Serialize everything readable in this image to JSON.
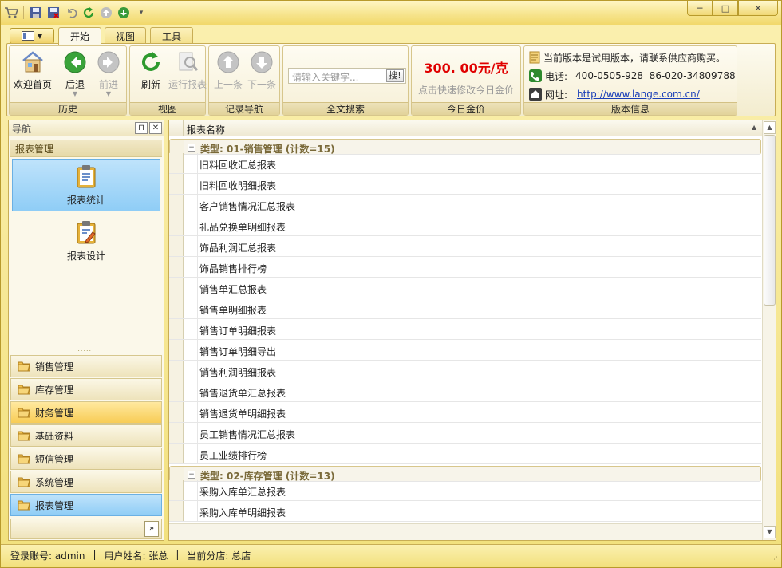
{
  "window": {
    "controls": {
      "minimize": "─",
      "maximize": "□",
      "close": "✕"
    }
  },
  "quick_access": [
    "cart-icon",
    "save-icon",
    "save-close-icon",
    "undo-icon",
    "refresh-icon",
    "up-icon",
    "down-icon",
    "customize-icon"
  ],
  "tabs": [
    {
      "label": "开始",
      "active": true
    },
    {
      "label": "视图",
      "active": false
    },
    {
      "label": "工具",
      "active": false
    }
  ],
  "ribbon": {
    "history": {
      "label": "历史",
      "buttons": [
        {
          "label": "欢迎首页",
          "icon": "home-icon",
          "enabled": true
        },
        {
          "label": "后退",
          "icon": "back-icon",
          "enabled": true
        },
        {
          "label": "前进",
          "icon": "forward-icon",
          "enabled": false
        }
      ]
    },
    "view": {
      "label": "视图",
      "buttons": [
        {
          "label": "刷新",
          "icon": "refresh-icon",
          "enabled": true
        },
        {
          "label": "运行报表",
          "icon": "run-report-icon",
          "enabled": false
        }
      ]
    },
    "record_nav": {
      "label": "记录导航",
      "buttons": [
        {
          "label": "上一条",
          "icon": "up-icon",
          "enabled": false
        },
        {
          "label": "下一条",
          "icon": "down-icon",
          "enabled": false
        }
      ]
    },
    "search": {
      "label": "全文搜索",
      "placeholder": "请输入关键字...",
      "button": "搜!"
    },
    "gold": {
      "label": "今日金价",
      "price": "300. 00元/克",
      "hint": "点击快速修改今日金价"
    },
    "version": {
      "label": "版本信息",
      "notice": "当前版本是试用版本，请联系供应商购买。",
      "phone_label": "电话:",
      "phone": "400-0505-928  86-020-34809788",
      "site_label": "网址:",
      "site": "http://www.lange.com.cn/"
    }
  },
  "nav": {
    "title": "导航",
    "pin": "ㅁ",
    "close": "✕",
    "section": "报表管理",
    "big_items": [
      {
        "label": "报表统计",
        "selected": true
      },
      {
        "label": "报表设计",
        "selected": false
      }
    ],
    "splitter": "......",
    "groups": [
      {
        "label": "销售管理",
        "state": "normal"
      },
      {
        "label": "库存管理",
        "state": "normal"
      },
      {
        "label": "财务管理",
        "state": "hover"
      },
      {
        "label": "基础资料",
        "state": "normal"
      },
      {
        "label": "短信管理",
        "state": "normal"
      },
      {
        "label": "系统管理",
        "state": "normal"
      },
      {
        "label": "报表管理",
        "state": "selected"
      }
    ],
    "more": "»"
  },
  "grid": {
    "column": "报表名称",
    "rows": [
      {
        "type": "group",
        "text": "类型: 01-销售管理 (计数=15)"
      },
      {
        "type": "item",
        "text": "旧料回收汇总报表"
      },
      {
        "type": "item",
        "text": "旧料回收明细报表"
      },
      {
        "type": "item",
        "text": "客户销售情况汇总报表"
      },
      {
        "type": "item",
        "text": "礼品兑换单明细报表"
      },
      {
        "type": "item",
        "text": "饰品利润汇总报表"
      },
      {
        "type": "item",
        "text": "饰品销售排行榜"
      },
      {
        "type": "item",
        "text": "销售单汇总报表"
      },
      {
        "type": "item",
        "text": "销售单明细报表"
      },
      {
        "type": "item",
        "text": "销售订单明细报表"
      },
      {
        "type": "item",
        "text": "销售订单明细导出"
      },
      {
        "type": "item",
        "text": "销售利润明细报表"
      },
      {
        "type": "item",
        "text": "销售退货单汇总报表"
      },
      {
        "type": "item",
        "text": "销售退货单明细报表"
      },
      {
        "type": "item",
        "text": "员工销售情况汇总报表"
      },
      {
        "type": "item",
        "text": "员工业绩排行榜"
      },
      {
        "type": "group",
        "text": "类型: 02-库存管理 (计数=13)"
      },
      {
        "type": "item",
        "text": "采购入库单汇总报表"
      },
      {
        "type": "item",
        "text": "采购入库单明细报表"
      }
    ]
  },
  "status": {
    "account": "登录账号: admin",
    "sep1": "|",
    "user": "用户姓名: 张总",
    "sep2": "|",
    "branch": "当前分店: 总店"
  }
}
